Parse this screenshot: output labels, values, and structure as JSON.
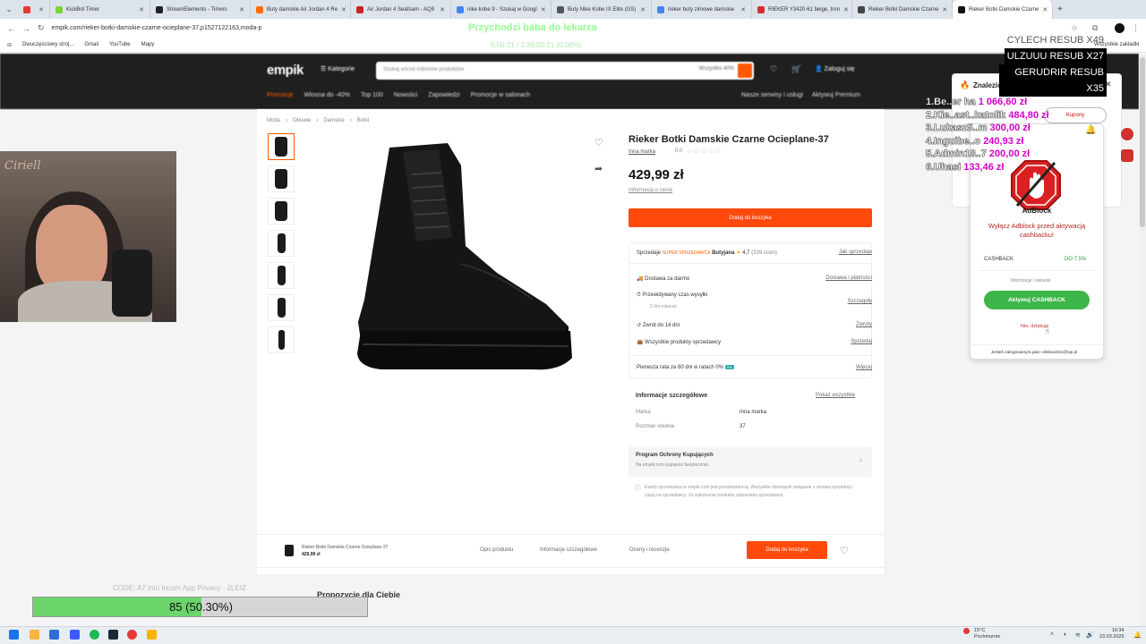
{
  "browser": {
    "tabs": [
      {
        "label": "",
        "color": "#e53935"
      },
      {
        "label": "KickBot Timer",
        "color": "#7cd03b"
      },
      {
        "label": "StreamElements - Timers",
        "color": "#222222"
      },
      {
        "label": "Buty damskie Air Jordan 4 Re",
        "color": "#ff6d00"
      },
      {
        "label": "Air Jordan 4 Seafoam - AQ9",
        "color": "#cc2222"
      },
      {
        "label": "nike kobe 9 - Szukaj w Googl",
        "color": "#4285f4"
      },
      {
        "label": "Buty Nike Kobe IX Elite (GS)",
        "color": "#555555"
      },
      {
        "label": "rieker buty zimowe damskie",
        "color": "#4285f4"
      },
      {
        "label": "RIEKER Y3420-61 beige, tron",
        "color": "#d32f2f"
      },
      {
        "label": "Rieker Botki Damskie Czarne",
        "color": "#444444"
      },
      {
        "label": "Rieker Botki Damskie Czarne",
        "color": "#111111"
      }
    ],
    "url": "empik.com/rieker-botki-damskie-czarne-ocieplane-37,p1527122163,moda-p",
    "bookmarks": [
      "Dwuczęściowy stroj...",
      "Gmail",
      "YouTube",
      "Mapy"
    ],
    "bookmarks_right": "Wszystkie zakładki"
  },
  "site": {
    "logo": "empik",
    "categories": "Kategorie",
    "search_placeholder": "Szukaj wśród milionów produktów",
    "search_scope": "Wszystko 40%",
    "login": "Zaloguj się",
    "menu": [
      "Promocje",
      "Wiosna do -40%",
      "Top 100",
      "Nowości",
      "Zapowiedzi",
      "Promocje w salonach"
    ],
    "menu_right": [
      "Nasze serwisy i usługi",
      "Aktywuj Premium"
    ],
    "breadcrumb": [
      "Moda",
      "Obuwie",
      "Damskie",
      "Botki"
    ]
  },
  "product": {
    "title": "Rieker Botki Damskie Czarne Ocieplane-37",
    "brand": "Inna marka",
    "rating_value": "0,0",
    "price": "429,99 zł",
    "price_info": "Informacja o cenie",
    "add_to_cart": "Dodaj do koszyka",
    "seller_label": "Sprzedaje",
    "seller_badge": "SUPER SPRZEDAWCA",
    "seller_name": "Butyjana",
    "seller_rating": "4,7",
    "seller_reviews": "(339 ocen)",
    "seller_link": "Jak sprzedaje",
    "rows": [
      {
        "label": "Dostawa za darmo",
        "link": "Dostawa i płatności",
        "sub": ""
      },
      {
        "label": "Przewidywany czas wysyłki",
        "link": "Szczegóły",
        "sub": "2 dni robocze"
      },
      {
        "label": "Zwrot do 14 dni",
        "link": "Zwroty",
        "sub": ""
      },
      {
        "label": "Wszystkie produkty sprzedawcy",
        "link": "Sprzedaj",
        "sub": ""
      },
      {
        "label": "Pierwsza rata za 60 dni w ratach 0%",
        "link": "Więcej",
        "sub": ""
      }
    ],
    "details_title": "Informacje szczegółowe",
    "details_link": "Pokaż wszystkie",
    "details": [
      {
        "label": "Marka",
        "value": "Inna marka"
      },
      {
        "label": "Rozmiar obuwia",
        "value": "37"
      }
    ],
    "protection_title": "Program Ochrony Kupujących",
    "protection_sub": "Na empik.com kupujesz bezpiecznie.",
    "disclaimer": "Każdy sprzedawca w empik.com jest przedsiębiorcą. Wszystkie obowiązki związane z umową sprzedaży ciążą na sprzedawcy. Za wykonanie produktu odpowiada sprzedawca."
  },
  "sticky_bar": {
    "name": "Rieker Botki Damskie Czarne Ocieplane-37",
    "price": "429,99 zł",
    "tabs": [
      "Opis produktu",
      "Informacje szczegółowe",
      "Oceny i recenzje"
    ],
    "cart": "Dodaj do koszyka"
  },
  "recommendations_title": "Propozycje dla Ciebie",
  "overlay": {
    "top_text": "Przychodzi baba do lekarza",
    "top_sub": "0:00:21 / 3:39:00:21 (0.00%)",
    "sub_list": [
      "CYLECH RESUB X49",
      "ULZUUU RESUB X27",
      "GERUDRIR RESUB X35"
    ],
    "donors": [
      {
        "name": "1.Be..er ha",
        "amount": "1 066,60 zł"
      },
      {
        "name": "2.Kie..ast..katolik",
        "amount": "484,80 zł"
      },
      {
        "name": "3.Lukasz5..m",
        "amount": "300,00 zł"
      },
      {
        "name": "4.Inguibe..o",
        "amount": "240,93 zł"
      },
      {
        "name": "5.Admin18..7",
        "amount": "200,00 zł"
      },
      {
        "name": "6.Uhasi",
        "amount": "133,46 zł"
      }
    ],
    "webcam_sign": "Ciriell",
    "progress_value": 85,
    "progress_percent": 50.3,
    "progress_text": "85 (50.30%)",
    "progress_above": "CODE: A7 into Incom App Privacy - 2LEIZ"
  },
  "extension": {
    "header": "Znaleziono oferty!",
    "coupons": "Kupony",
    "adblock_label": "AdBlock",
    "adblock_msg": "Wyłącz Adblock przed aktywacją cashbacku!",
    "cashback_label": "CASHBACK",
    "cashback_value": "DO 7,5%",
    "info": "Informacje i warunki",
    "activate": "Aktywuj CASHBACK",
    "decline": "Nie, dziękuję",
    "footer": "Jesteś zalogowany/a jako: eliska1531@wp.pl"
  },
  "taskbar": {
    "weather_temp": "15°C",
    "weather_desc": "Pochmurnie",
    "time": "16:34",
    "date": "23.03.2026"
  }
}
